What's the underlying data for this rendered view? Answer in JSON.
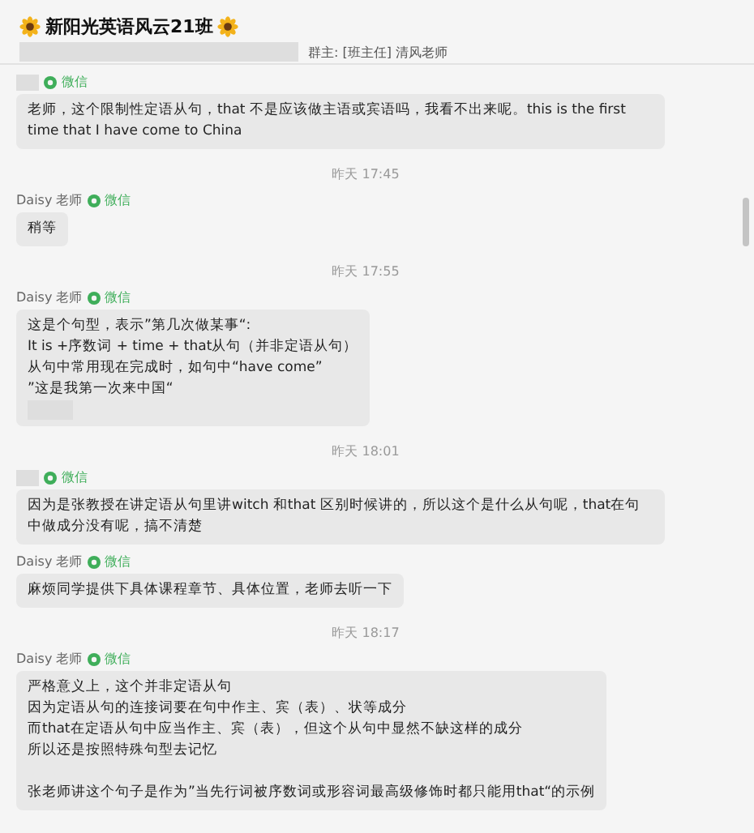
{
  "header": {
    "title": "新阳光英语风云21班",
    "subtitle": "群主: [班主任] 清风老师"
  },
  "messages": [
    {
      "kind": "message",
      "sender": {
        "name_redacted": true,
        "tag": "微信"
      },
      "lines": [
        "老师，这个限制性定语从句，that 不是应该做主语或宾语吗，我看不出来呢。this is the first time that I have come to China"
      ]
    },
    {
      "kind": "time",
      "text": "昨天 17:45"
    },
    {
      "kind": "message",
      "sender": {
        "name": "Daisy 老师",
        "tag": "微信"
      },
      "lines": [
        "稍等"
      ]
    },
    {
      "kind": "time",
      "text": "昨天 17:55"
    },
    {
      "kind": "message",
      "sender": {
        "name": "Daisy 老师",
        "tag": "微信"
      },
      "lines": [
        "这是个句型，表示”第几次做某事“:",
        "It is +序数词 + time + that从句（并非定语从句）",
        "从句中常用现在完成时，如句中“have come”",
        "”这是我第一次来中国“"
      ],
      "redacted_tail": true
    },
    {
      "kind": "time",
      "text": "昨天 18:01"
    },
    {
      "kind": "message",
      "sender": {
        "name_redacted": true,
        "tag": "微信"
      },
      "lines": [
        "因为是张教授在讲定语从句里讲witch 和that 区别时候讲的，所以这个是什么从句呢，that在句中做成分没有呢，搞不清楚"
      ]
    },
    {
      "kind": "message",
      "sender": {
        "name": "Daisy 老师",
        "tag": "微信"
      },
      "lines": [
        "麻烦同学提供下具体课程章节、具体位置，老师去听一下"
      ]
    },
    {
      "kind": "time",
      "text": "昨天 18:17"
    },
    {
      "kind": "message",
      "sender": {
        "name": "Daisy 老师",
        "tag": "微信"
      },
      "lines": [
        "严格意义上，这个并非定语从句",
        "因为定语从句的连接词要在句中作主、宾（表）、状等成分",
        "而that在定语从句中应当作主、宾（表），但这个从句中显然不缺这样的成分",
        "所以还是按照特殊句型去记忆"
      ],
      "lines_after_gap": [
        "张老师讲这个句子是作为”当先行词被序数词或形容词最高级修饰时都只能用that“的示例"
      ]
    }
  ]
}
